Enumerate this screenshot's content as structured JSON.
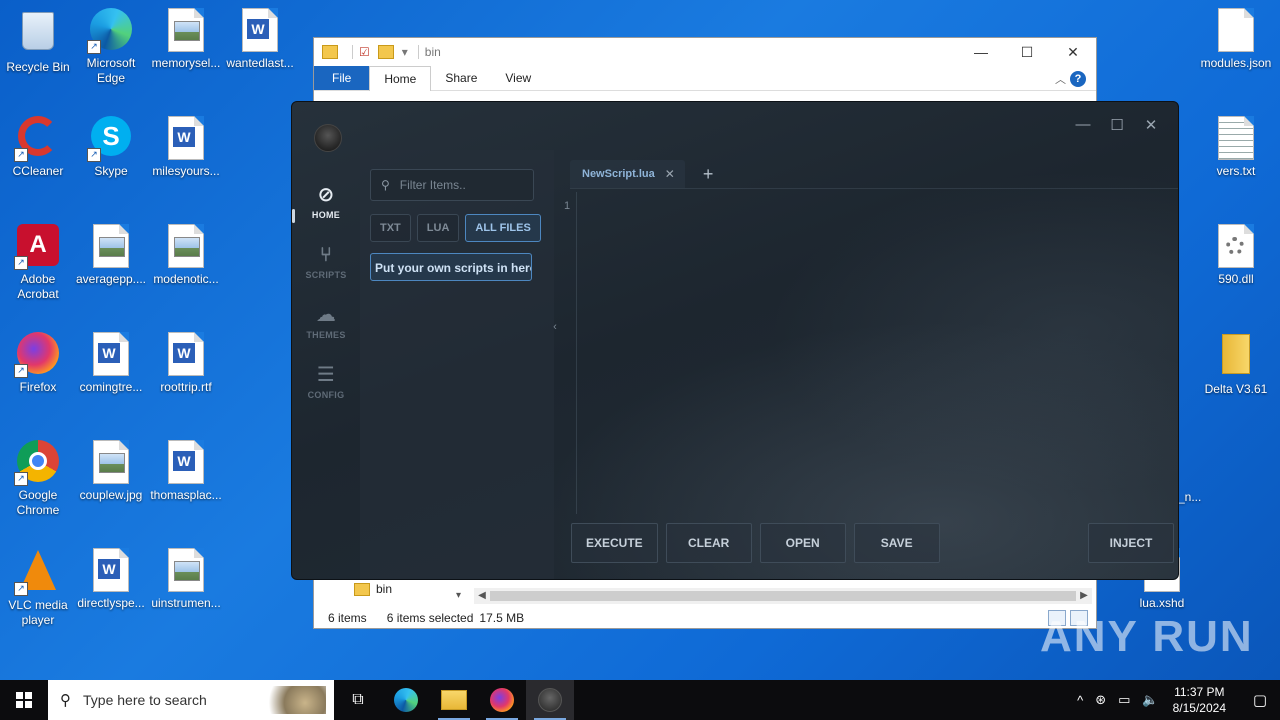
{
  "desktop": {
    "icons": [
      {
        "label": "Recycle Bin"
      },
      {
        "label": "Microsoft Edge"
      },
      {
        "label": "memorysel..."
      },
      {
        "label": "wantedlast..."
      },
      {
        "label": "CCleaner"
      },
      {
        "label": "Skype"
      },
      {
        "label": "milesyours..."
      },
      {
        "label": "Adobe Acrobat"
      },
      {
        "label": "averagepp...."
      },
      {
        "label": "modenotic..."
      },
      {
        "label": "Firefox"
      },
      {
        "label": "comingtre..."
      },
      {
        "label": "roottrip.rtf"
      },
      {
        "label": "Google Chrome"
      },
      {
        "label": "couplew.jpg"
      },
      {
        "label": "thomasplac..."
      },
      {
        "label": "VLC media player"
      },
      {
        "label": "directlyspe..."
      },
      {
        "label": "uinstrumen..."
      },
      {
        "label": "modules.json"
      },
      {
        "label": "vers.txt"
      },
      {
        "label": "590.dll"
      },
      {
        "label": "Delta V3.61"
      },
      {
        "label": "lua.xshd"
      },
      {
        "label": "_n..."
      }
    ]
  },
  "explorer": {
    "title": "bin",
    "ribbon_tabs": [
      "File",
      "Home",
      "Share",
      "View"
    ],
    "nav_folder": "bin",
    "status": {
      "items": "6 items",
      "selected": "6 items selected",
      "size": "17.5 MB"
    }
  },
  "app": {
    "nav": [
      {
        "label": "HOME"
      },
      {
        "label": "SCRIPTS"
      },
      {
        "label": "THEMES"
      },
      {
        "label": "CONFIG"
      }
    ],
    "search_placeholder": "Filter Items..",
    "filters": [
      "TXT",
      "LUA",
      "ALL FILES"
    ],
    "active_filter": "ALL FILES",
    "file_item": "Put your own scripts in here",
    "tab": "NewScript.lua",
    "line_number": "1",
    "buttons": {
      "execute": "EXECUTE",
      "clear": "CLEAR",
      "open": "OPEN",
      "save": "SAVE",
      "inject": "INJECT"
    }
  },
  "taskbar": {
    "search_placeholder": "Type here to search",
    "time": "11:37 PM",
    "date": "8/15/2024"
  },
  "watermark": "ANY RUN"
}
